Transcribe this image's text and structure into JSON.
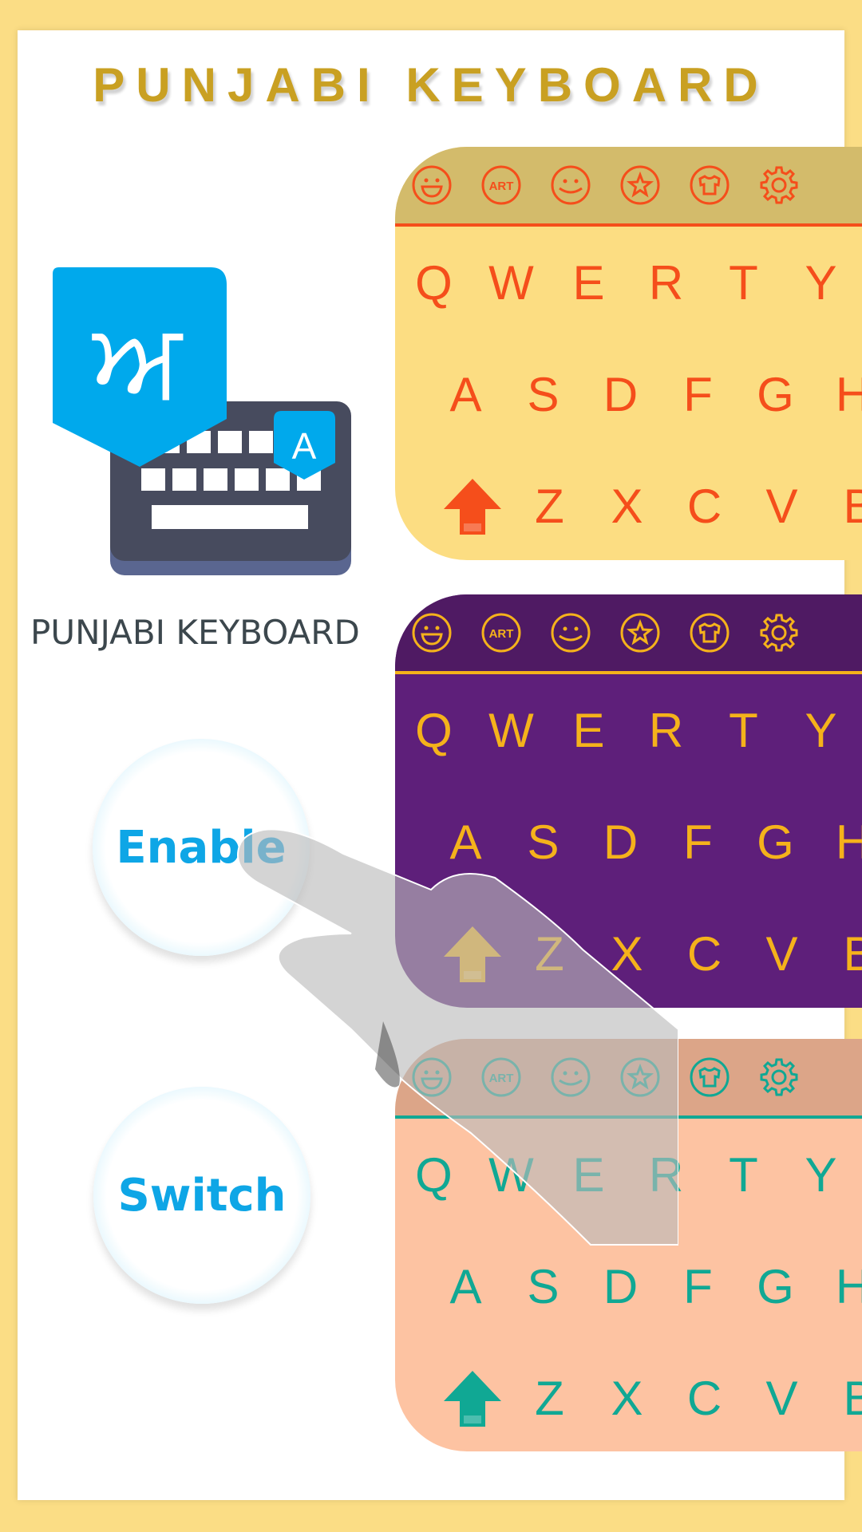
{
  "header": {
    "title": "PUNJABI KEYBOARD"
  },
  "app": {
    "label": "PUNJABI KEYBOARD",
    "logo": {
      "primary_glyph": "ਅ",
      "secondary_glyph": "A",
      "accent_color": "#00a9ec",
      "keyboard_color": "#474b5e"
    }
  },
  "buttons": {
    "enable_label": "Enable",
    "switch_label": "Switch",
    "text_color": "#0ea6e6"
  },
  "keyboards": [
    {
      "name": "yellow-theme",
      "background": "#fcdd82",
      "toolbar_background": "#d3bb6b",
      "accent_color": "#f54e1b",
      "toolbar_icons": [
        "laughing-emoji-icon",
        "art-icon",
        "smiley-icon",
        "star-icon",
        "tshirt-theme-icon",
        "gear-icon"
      ],
      "rows": [
        [
          "Q",
          "W",
          "E",
          "R",
          "T",
          "Y"
        ],
        [
          "A",
          "S",
          "D",
          "F",
          "G",
          "H"
        ],
        [
          "Z",
          "X",
          "C",
          "V",
          "B"
        ]
      ]
    },
    {
      "name": "purple-theme",
      "background": "#5e1f7a",
      "toolbar_background": "#4f1a63",
      "accent_color": "#f5b21b",
      "toolbar_icons": [
        "laughing-emoji-icon",
        "art-icon",
        "smiley-icon",
        "star-icon",
        "tshirt-theme-icon",
        "gear-icon"
      ],
      "rows": [
        [
          "Q",
          "W",
          "E",
          "R",
          "T",
          "Y"
        ],
        [
          "A",
          "S",
          "D",
          "F",
          "G",
          "H"
        ],
        [
          "Z",
          "X",
          "C",
          "V",
          "B"
        ]
      ]
    },
    {
      "name": "peach-theme",
      "background": "#fdc3a2",
      "toolbar_background": "#dca588",
      "accent_color": "#10a894",
      "toolbar_icons": [
        "laughing-emoji-icon",
        "art-icon",
        "smiley-icon",
        "star-icon",
        "tshirt-theme-icon",
        "gear-icon"
      ],
      "rows": [
        [
          "Q",
          "W",
          "E",
          "R",
          "T",
          "Y"
        ],
        [
          "A",
          "S",
          "D",
          "F",
          "G",
          "H"
        ],
        [
          "Z",
          "X",
          "C",
          "V",
          "B"
        ]
      ]
    }
  ],
  "icons": {
    "art_text": "ART"
  }
}
